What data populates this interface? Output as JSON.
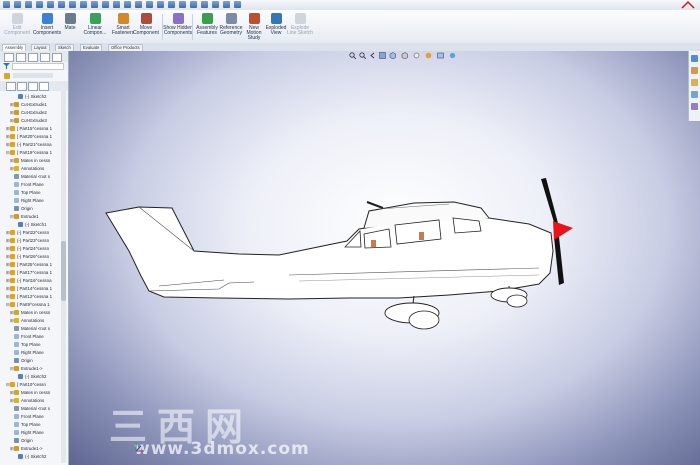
{
  "ribbon": {
    "buttons": [
      {
        "label": "Edit Component",
        "disabled": true,
        "color": "#9aa3af"
      },
      {
        "label": "Insert Components",
        "disabled": false,
        "color": "#3f7fd6"
      },
      {
        "label": "Mate",
        "disabled": false,
        "color": "#6c7a8f"
      },
      {
        "label": "Linear Compon...",
        "disabled": false,
        "color": "#3aa05a"
      },
      {
        "label": "Smart Fasteners",
        "disabled": false,
        "color": "#d08a2c"
      },
      {
        "label": "Move Component",
        "disabled": false,
        "color": "#b04a3a"
      },
      {
        "label": "Show Hidden Components",
        "disabled": false,
        "color": "#8a6fc4"
      },
      {
        "label": "Assembly Features",
        "disabled": false,
        "color": "#3c9d4d"
      },
      {
        "label": "Reference Geometry",
        "disabled": false,
        "color": "#7a8ca8"
      },
      {
        "label": "New Motion Study",
        "disabled": false,
        "color": "#c0502d"
      },
      {
        "label": "Exploded View",
        "disabled": false,
        "color": "#3477b8"
      },
      {
        "label": "Explode Line Sketch",
        "disabled": true,
        "color": "#9aa3af"
      }
    ]
  },
  "tabs": [
    "Assembly",
    "Layout",
    "Sketch",
    "Evaluate",
    "Office Products"
  ],
  "active_tab": "Assembly",
  "feature_tree": [
    {
      "indent": 3,
      "expander": "",
      "icon": "sketch-icon",
      "label": "(-) Sketch2"
    },
    {
      "indent": 2,
      "expander": "⊞",
      "icon": "cut-extrude-icon",
      "label": "Cut-Extrude1"
    },
    {
      "indent": 2,
      "expander": "⊞",
      "icon": "cut-extrude-icon",
      "label": "Cut-Extrude2"
    },
    {
      "indent": 2,
      "expander": "⊞",
      "icon": "cut-extrude-icon",
      "label": "Cut-Extrude3"
    },
    {
      "indent": 1,
      "expander": "⊞",
      "icon": "part-icon",
      "label": "[ Part15^cessna 1"
    },
    {
      "indent": 1,
      "expander": "⊞",
      "icon": "part-icon",
      "label": "[ Part20^cessna 1"
    },
    {
      "indent": 1,
      "expander": "⊞",
      "icon": "part-icon",
      "label": "(-) Part21^cessna"
    },
    {
      "indent": 1,
      "expander": "⊟",
      "icon": "part-icon",
      "label": "[ Part19^cessna 1"
    },
    {
      "indent": 2,
      "expander": "⊞",
      "icon": "mates-icon",
      "label": "Mates in cessn"
    },
    {
      "indent": 2,
      "expander": "⊞",
      "icon": "annotations-icon",
      "label": "Annotations"
    },
    {
      "indent": 2,
      "expander": "",
      "icon": "material-icon",
      "label": "Material <not s"
    },
    {
      "indent": 2,
      "expander": "",
      "icon": "plane-icon",
      "label": "Front Plane"
    },
    {
      "indent": 2,
      "expander": "",
      "icon": "plane-icon",
      "label": "Top Plane"
    },
    {
      "indent": 2,
      "expander": "",
      "icon": "plane-icon",
      "label": "Right Plane"
    },
    {
      "indent": 2,
      "expander": "",
      "icon": "origin-icon",
      "label": "Origin"
    },
    {
      "indent": 2,
      "expander": "⊟",
      "icon": "extrude-icon",
      "label": "Extrude1"
    },
    {
      "indent": 3,
      "expander": "",
      "icon": "sketch-icon",
      "label": "(-) Sketch1"
    },
    {
      "indent": 1,
      "expander": "⊞",
      "icon": "part-icon",
      "label": "(-) Part22^cessn"
    },
    {
      "indent": 1,
      "expander": "⊞",
      "icon": "part-icon",
      "label": "(-) Part23^cessn"
    },
    {
      "indent": 1,
      "expander": "⊞",
      "icon": "part-icon",
      "label": "(-) Part24^cessn"
    },
    {
      "indent": 1,
      "expander": "⊞",
      "icon": "part-icon",
      "label": "(-) Part26^cessn"
    },
    {
      "indent": 1,
      "expander": "⊞",
      "icon": "part-icon",
      "label": "[ Part25^cessna 1"
    },
    {
      "indent": 1,
      "expander": "⊞",
      "icon": "part-icon",
      "label": "[ Part17^cessna 1"
    },
    {
      "indent": 1,
      "expander": "⊞",
      "icon": "part-icon",
      "label": "(-) Part16^cessna"
    },
    {
      "indent": 1,
      "expander": "⊞",
      "icon": "part-icon",
      "label": "[ Part14^cessna 1"
    },
    {
      "indent": 1,
      "expander": "⊞",
      "icon": "part-icon",
      "label": "[ Part12^cessna 1"
    },
    {
      "indent": 1,
      "expander": "⊟",
      "icon": "part-icon",
      "label": "[ Part9^cessna 1"
    },
    {
      "indent": 2,
      "expander": "⊞",
      "icon": "mates-icon",
      "label": "Mates in cessn"
    },
    {
      "indent": 2,
      "expander": "⊞",
      "icon": "annotations-icon",
      "label": "Annotations"
    },
    {
      "indent": 2,
      "expander": "",
      "icon": "material-icon",
      "label": "Material <not s"
    },
    {
      "indent": 2,
      "expander": "",
      "icon": "plane-icon",
      "label": "Front Plane"
    },
    {
      "indent": 2,
      "expander": "",
      "icon": "plane-icon",
      "label": "Top Plane"
    },
    {
      "indent": 2,
      "expander": "",
      "icon": "plane-icon",
      "label": "Right Plane"
    },
    {
      "indent": 2,
      "expander": "",
      "icon": "origin-icon",
      "label": "Origin"
    },
    {
      "indent": 2,
      "expander": "⊟",
      "icon": "extrude-icon",
      "label": "Extrude1->"
    },
    {
      "indent": 3,
      "expander": "",
      "icon": "sketch-icon",
      "label": "(-) Sketch2"
    },
    {
      "indent": 1,
      "expander": "⊟",
      "icon": "part-icon",
      "label": "[ Part10^cessn"
    },
    {
      "indent": 2,
      "expander": "⊞",
      "icon": "mates-icon",
      "label": "Mates in cessn"
    },
    {
      "indent": 2,
      "expander": "⊞",
      "icon": "annotations-icon",
      "label": "Annotations"
    },
    {
      "indent": 2,
      "expander": "",
      "icon": "material-icon",
      "label": "Material <not s"
    },
    {
      "indent": 2,
      "expander": "",
      "icon": "plane-icon",
      "label": "Front Plane"
    },
    {
      "indent": 2,
      "expander": "",
      "icon": "plane-icon",
      "label": "Top Plane"
    },
    {
      "indent": 2,
      "expander": "",
      "icon": "plane-icon",
      "label": "Right Plane"
    },
    {
      "indent": 2,
      "expander": "",
      "icon": "origin-icon",
      "label": "Origin"
    },
    {
      "indent": 2,
      "expander": "⊞",
      "icon": "extrude-icon",
      "label": "Extrude1->"
    },
    {
      "indent": 3,
      "expander": "",
      "icon": "sketch-icon",
      "label": "(-) Sketch2"
    }
  ],
  "icon_colors": {
    "part-icon": "#d9a531",
    "sketch-icon": "#5a7fb8",
    "cut-extrude-icon": "#c89a3a",
    "extrude-icon": "#c89a3a",
    "mates-icon": "#c9a63d",
    "annotations-icon": "#d4b23a",
    "material-icon": "#8896a8",
    "plane-icon": "#9fb4cf",
    "origin-icon": "#7f8fa3"
  },
  "watermark": {
    "chars": "三西网",
    "url": "www.3dmox.com"
  },
  "model": {
    "name": "cessna",
    "body_color": "#ffffff",
    "spinner_color": "#e8141a",
    "prop_color": "#111111"
  }
}
